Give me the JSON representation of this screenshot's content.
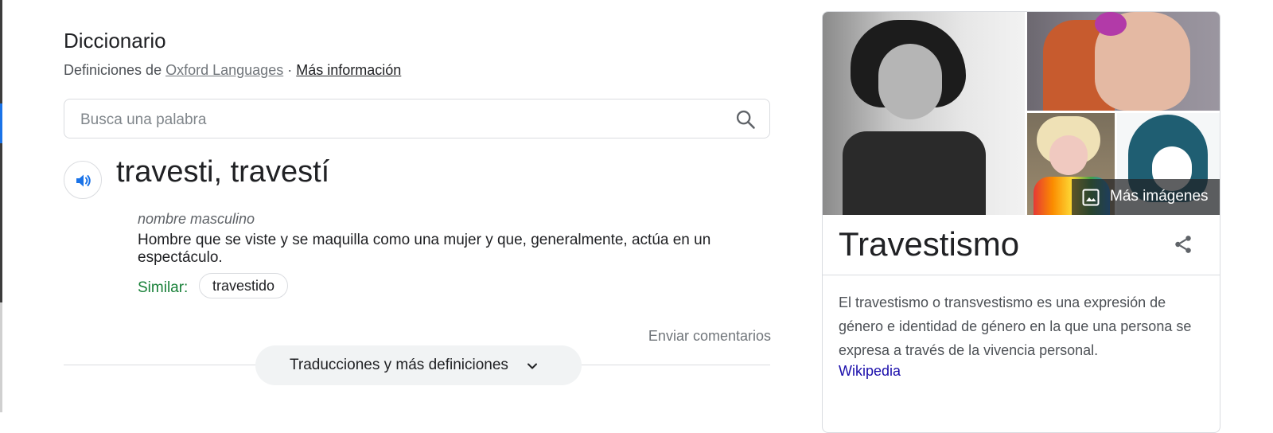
{
  "dictionary": {
    "title": "Diccionario",
    "source_prefix": "Definiciones de",
    "source_link": "Oxford Languages",
    "separator": "·",
    "more_info": "Más información",
    "search_placeholder": "Busca una palabra",
    "headword": "travesti, travestí",
    "part_of_speech": "nombre masculino",
    "definition": "Hombre que se viste y se maquilla como una mujer y que, generalmente, actúa en un espectáculo.",
    "similar_label": "Similar:",
    "similar_chip": "travestido",
    "feedback": "Enviar comentarios",
    "more_definitions": "Traducciones y más definiciones"
  },
  "knowledge_panel": {
    "more_images": "Más imágenes",
    "title": "Travestismo",
    "description": "El travestismo o transvestismo es una expresión de género e identidad de género en la que una persona se expresa a través de la vivencia personal.",
    "source_link": "Wikipedia"
  },
  "colors": {
    "link": "#1a0dab",
    "similar_label": "#188038",
    "audio_icon": "#1a73e8"
  },
  "icons": [
    "search-icon",
    "speaker-icon",
    "chevron-down-icon",
    "image-icon",
    "share-icon"
  ]
}
